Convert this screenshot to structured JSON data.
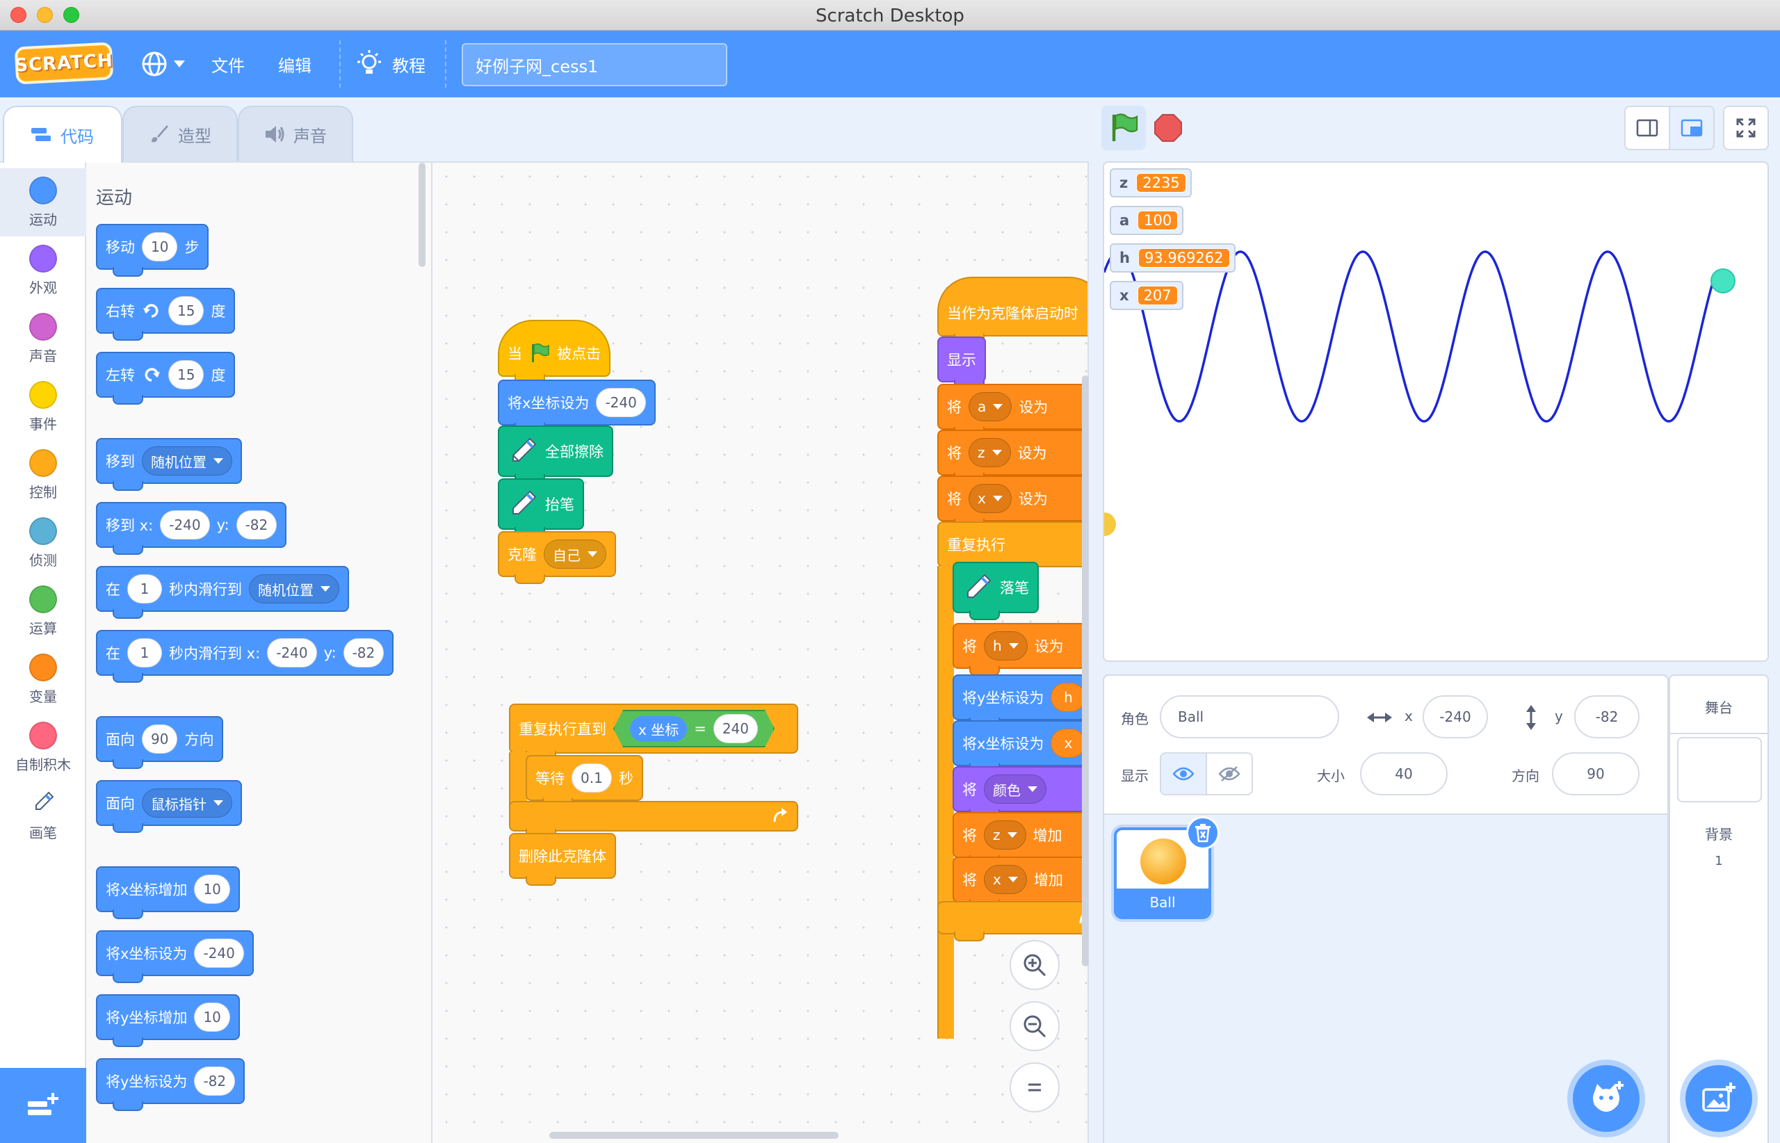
{
  "window": {
    "title": "Scratch Desktop"
  },
  "menu": {
    "file": "文件",
    "edit": "编辑",
    "tutorials": "教程",
    "project_title": "好例子网_cess1",
    "logo": "SCRATCH"
  },
  "tabs": {
    "code": "代码",
    "costumes": "造型",
    "sounds": "声音"
  },
  "categories": [
    {
      "label": "运动",
      "color": "#4c97ff"
    },
    {
      "label": "外观",
      "color": "#9966ff"
    },
    {
      "label": "声音",
      "color": "#cf63cf"
    },
    {
      "label": "事件",
      "color": "#ffd500"
    },
    {
      "label": "控制",
      "color": "#ffab19"
    },
    {
      "label": "侦测",
      "color": "#5cb1d6"
    },
    {
      "label": "运算",
      "color": "#59c059"
    },
    {
      "label": "变量",
      "color": "#ff8c1a"
    },
    {
      "label": "自制积木",
      "color": "#ff6680"
    },
    {
      "label": "画笔",
      "color": "#0fbd8c"
    }
  ],
  "palette": {
    "heading": "运动",
    "move": {
      "a": "移动",
      "v": "10",
      "b": "步"
    },
    "turn_right": {
      "a": "右转",
      "v": "15",
      "b": "度"
    },
    "turn_left": {
      "a": "左转",
      "v": "15",
      "b": "度"
    },
    "goto": {
      "a": "移到",
      "d": "随机位置"
    },
    "goto_xy": {
      "a": "移到 x:",
      "x": "-240",
      "b": "y:",
      "y": "-82"
    },
    "glide_to": {
      "a": "在",
      "v": "1",
      "b": "秒内滑行到",
      "d": "随机位置"
    },
    "glide_xy": {
      "a": "在",
      "v": "1",
      "b": "秒内滑行到 x:",
      "x": "-240",
      "c": "y:",
      "y": "-82"
    },
    "point_dir": {
      "a": "面向",
      "v": "90",
      "b": "方向"
    },
    "point_to": {
      "a": "面向",
      "d": "鼠标指针"
    },
    "change_x": {
      "a": "将x坐标增加",
      "v": "10"
    },
    "set_x": {
      "a": "将x坐标设为",
      "v": "-240"
    },
    "change_y": {
      "a": "将y坐标增加",
      "v": "10"
    },
    "set_y": {
      "a": "将y坐标设为",
      "v": "-82"
    }
  },
  "script1": {
    "hat_a": "当",
    "hat_b": "被点击",
    "setx": "将x坐标设为",
    "setx_v": "-240",
    "clear": "全部擦除",
    "penup": "抬笔",
    "clone": "克隆",
    "clone_d": "自己"
  },
  "script2": {
    "repeat_until": "重复执行直到",
    "xpos": "x 坐标",
    "eq": "=",
    "eq_v": "240",
    "wait": "等待",
    "wait_v": "0.1",
    "wait_unit": "秒",
    "delete_clone": "删除此克隆体"
  },
  "script3": {
    "hat": "当作为克隆体启动时",
    "show": "显示",
    "set": "将",
    "to": "设为",
    "change": "增加",
    "var_a": "a",
    "var_z": "z",
    "var_x": "x",
    "var_h": "h",
    "forever": "重复执行",
    "pendown": "落笔",
    "sety": "将y坐标设为",
    "sety_v": "h",
    "setx": "将x坐标设为",
    "setx_v": "x",
    "color_d": "颜色"
  },
  "stage": {
    "monitors": [
      {
        "name": "z",
        "value": "2235"
      },
      {
        "name": "a",
        "value": "100"
      },
      {
        "name": "h",
        "value": "93.969262"
      },
      {
        "name": "x",
        "value": "207"
      }
    ]
  },
  "sprite_info": {
    "sprite_label": "角色",
    "sprite_name": "Ball",
    "x_label": "x",
    "x_value": "-240",
    "y_label": "y",
    "y_value": "-82",
    "show_label": "显示",
    "size_label": "大小",
    "size_value": "40",
    "direction_label": "方向",
    "direction_value": "90"
  },
  "sprites": [
    {
      "name": "Ball"
    }
  ],
  "stage_panel": {
    "title": "舞台",
    "backdrops_label": "背景",
    "backdrops_count": "1"
  }
}
